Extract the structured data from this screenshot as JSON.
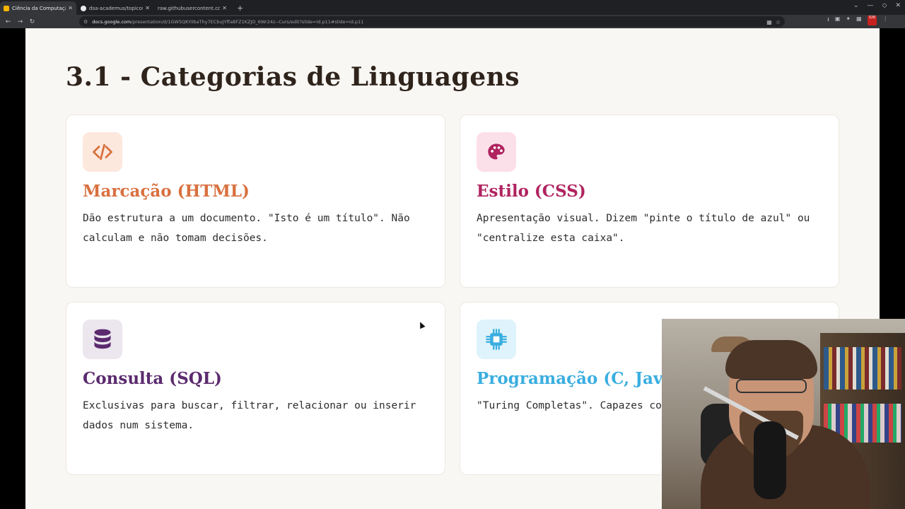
{
  "browser": {
    "tabs": [
      {
        "title": "Ciência da Computação: Fi",
        "favicon_color": "#f4b400",
        "active": true
      },
      {
        "title": "dsa-academus/topicos/dy",
        "favicon_color": "#e8eaed",
        "active": false
      },
      {
        "title": "raw.githubusercontent.com/r",
        "favicon_color": "",
        "active": false
      }
    ],
    "url_host": "docs.google.com",
    "url_path": "/presentation/d/1GW5QKYiIbaThy7ECbuJYffaBFZ1KZJO_6Wr24z--Curs/edit?slide=id.p11#slide=id.p11",
    "extension_badge": "326"
  },
  "slide": {
    "title": "3.1 - Categorias de Linguagens",
    "cards": [
      {
        "title": "Marcação (HTML)",
        "desc": "Dão estrutura a um documento. \"Isto é um título\". Não calculam e não tomam decisões.",
        "icon": "code-icon",
        "title_color": "#d9703f",
        "icon_bg": "#fde8de",
        "icon_fg": "#d9703f"
      },
      {
        "title": "Estilo (CSS)",
        "desc": "Apresentação visual. Dizem \"pinte o título de azul\" ou \"centralize esta caixa\".",
        "icon": "palette-icon",
        "title_color": "#b0235f",
        "icon_bg": "#fbe0e9",
        "icon_fg": "#b0235f"
      },
      {
        "title": "Consulta (SQL)",
        "desc": "Exclusivas para buscar, filtrar, relacionar ou inserir dados num sistema.",
        "icon": "database-icon",
        "title_color": "#5b2a6e",
        "icon_bg": "#ece6ef",
        "icon_fg": "#5b2a6e"
      },
      {
        "title": "Programação (C, Jav",
        "desc": "\"Turing Completas\". Capazes condicionais e loops de repe",
        "icon": "chip-icon",
        "title_color": "#3aaee0",
        "icon_bg": "#def3fb",
        "icon_fg": "#3aaee0"
      }
    ]
  }
}
